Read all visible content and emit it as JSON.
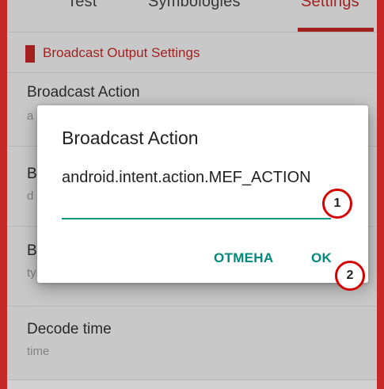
{
  "tabs": [
    {
      "label": "Test",
      "active": false
    },
    {
      "label": "Symbologies",
      "active": false
    },
    {
      "label": "Settings",
      "active": true
    }
  ],
  "section": {
    "title": "Broadcast Output Settings"
  },
  "settings_rows": [
    {
      "title": "Broadcast Action",
      "subtitle": "a"
    },
    {
      "title": "B",
      "subtitle": "d"
    },
    {
      "title": "B",
      "subtitle": "ty"
    },
    {
      "title": "Decode time",
      "subtitle": "time"
    }
  ],
  "dialog": {
    "title": "Broadcast Action",
    "input_value": "android.intent.action.MEF_ACTION",
    "cancel_label": "ОТМЕНА",
    "ok_label": "OK"
  },
  "markers": [
    "1",
    "2"
  ],
  "colors": {
    "accent": "#c62828",
    "teal": "#00897b",
    "marker": "#d50000"
  }
}
